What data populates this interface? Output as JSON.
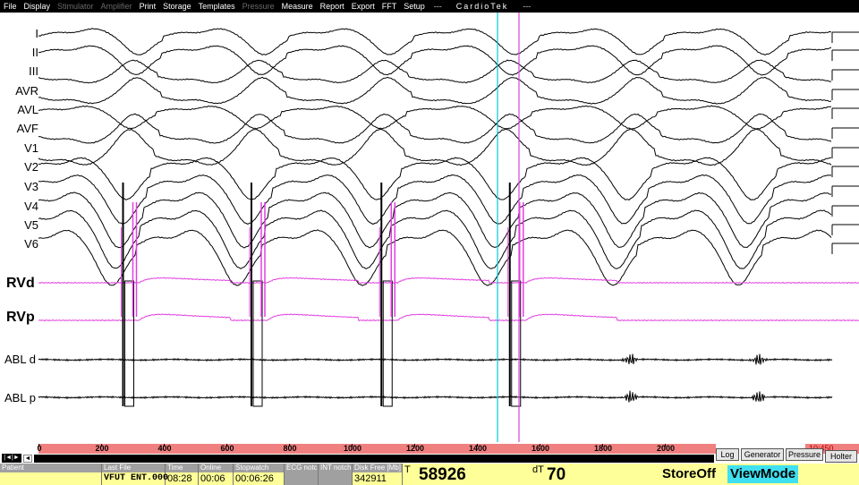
{
  "menu": {
    "items": [
      {
        "label": "File",
        "enabled": true
      },
      {
        "label": "Display",
        "enabled": true
      },
      {
        "label": "Stimulator",
        "enabled": false
      },
      {
        "label": "Amplifier",
        "enabled": false
      },
      {
        "label": "Print",
        "enabled": true
      },
      {
        "label": "Storage",
        "enabled": true
      },
      {
        "label": "Templates",
        "enabled": true
      },
      {
        "label": "Pressure",
        "enabled": false
      },
      {
        "label": "Measure",
        "enabled": true
      },
      {
        "label": "Report",
        "enabled": true
      },
      {
        "label": "Export",
        "enabled": true
      },
      {
        "label": "FFT",
        "enabled": true
      },
      {
        "label": "Setup",
        "enabled": true
      }
    ],
    "sep1": "---",
    "brand": "CardioTek",
    "sep2": "---"
  },
  "channels": {
    "ecg": [
      "I",
      "II",
      "III",
      "AVR",
      "AVL",
      "AVF",
      "V1",
      "V2",
      "V3",
      "V4",
      "V5",
      "V6"
    ],
    "rvd": "RVd",
    "rvp": "RVp",
    "abl_d": "ABL d",
    "abl_p": "ABL p"
  },
  "timeline": {
    "ticks": [
      "0",
      "200",
      "400",
      "600",
      "800",
      "1000",
      "1200",
      "1400",
      "1600",
      "1800",
      "2000"
    ],
    "tick_values": [
      0,
      200,
      400,
      600,
      800,
      1000,
      1200,
      1400,
      1600,
      1800,
      2000
    ],
    "overflow_text": "10:450",
    "scroll_button": "|◄|►",
    "scroll_left": "◄"
  },
  "tabs": {
    "log": "Log",
    "generator": "Generator",
    "pressure": "Pressure",
    "holter": "Holter"
  },
  "status": {
    "patient_label": "Patient",
    "patient_value": "",
    "last_file_label": "Last File",
    "last_file_value": "VFUT ENT.000",
    "time_label": "Time",
    "time_value": "08:28",
    "online_label": "Online",
    "online_value": "00:06",
    "stopwatch_label": "Stopwatch",
    "stopwatch_value": "00:06:26",
    "ecg_notch_label": "ECG notch",
    "int_notch_label": "INT notch",
    "disk_free_label": "Disk Free [Mb]",
    "disk_free_value": "342911",
    "t_label": "T",
    "t_value": "58926",
    "dt_label": "dT",
    "dt_value": "70",
    "store_off": "StoreOff",
    "view_mode": "ViewMode"
  },
  "colors": {
    "pacing": "#e040e0",
    "cursor1": "#00c8d8",
    "cursor2": "#e040e0",
    "ruler": "#f08080",
    "status_bg": "#ffff99",
    "view_mode_bg": "#40e0f0"
  },
  "beats_ms": [
    270,
    680,
    1095,
    1505
  ]
}
